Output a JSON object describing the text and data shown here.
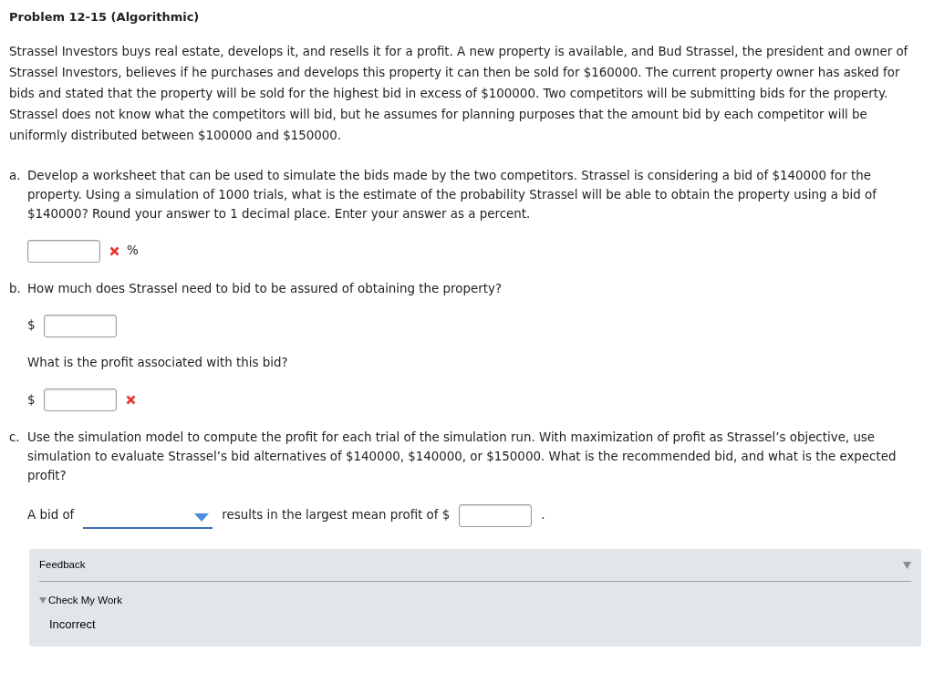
{
  "title": "Problem 12-15 (Algorithmic)",
  "intro": "Strassel Investors buys real estate, develops it, and resells it for a profit. A new property is available, and Bud Strassel, the president and owner of Strassel Investors, believes if he purchases and develops this property it can then be sold for $160000. The current property owner has asked for bids and stated that the property will be sold for the highest bid in excess of $100000. Two competitors will be submitting bids for the property. Strassel does not know what the competitors will bid, but he assumes for planning purposes that the amount bid by each competitor will be uniformly distributed between $100000 and $150000.",
  "parts": [
    {
      "label": "a.",
      "question": "Develop a worksheet that can be used to simulate the bids made by the two competitors. Strassel is considering a bid of $140000 for the property. Using a simulation of 1000 trials, what is the estimate of the probability Strassel will be able to obtain the property using a bid of $140000? Round your answer to 1 decimal place. Enter your answer as a percent.",
      "items": [
        {
          "kind": "answer",
          "incorrect": true,
          "suffix": "%"
        }
      ]
    },
    {
      "label": "b.",
      "question": "How much does Strassel need to bid to be assured of obtaining the property?",
      "items": [
        {
          "kind": "answer",
          "prefix": "$",
          "incorrect": false
        },
        {
          "kind": "text",
          "text": "What is the profit associated with this bid?"
        },
        {
          "kind": "answer",
          "prefix": "$",
          "incorrect": true
        }
      ]
    },
    {
      "label": "c.",
      "question": "Use the simulation model to compute the profit for each trial of the simulation run. With maximization of profit as Strassel’s objective, use simulation to evaluate Strassel’s bid alternatives of $140000, $140000, or $150000. What is the recommended bid, and what is the expected profit?",
      "items": [
        {
          "kind": "inline",
          "pieces": [
            {
              "kind": "text",
              "text": "A bid of"
            },
            {
              "kind": "dropdown"
            },
            {
              "kind": "text",
              "text": "results in the largest mean profit of $"
            },
            {
              "kind": "input",
              "incorrect": false
            },
            {
              "kind": "text",
              "text": "."
            }
          ]
        }
      ]
    }
  ],
  "feedback": {
    "title": "Feedback",
    "expanded": true,
    "check": {
      "label": "Check My Work",
      "expanded": true,
      "result": "Incorrect"
    }
  }
}
